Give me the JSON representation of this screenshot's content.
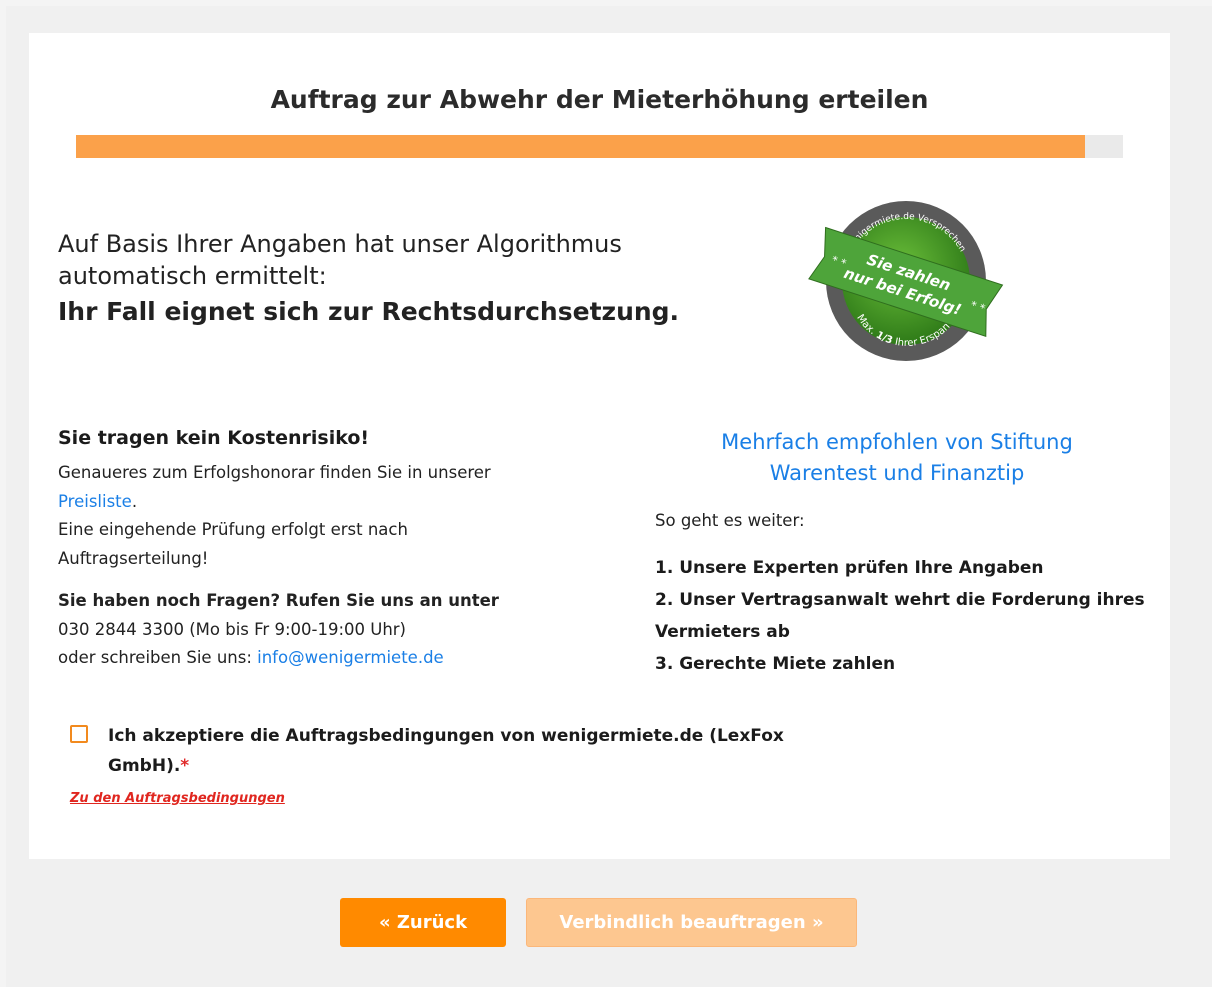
{
  "page": {
    "title": "Auftrag zur Abwehr der Mieterhöhung erteilen",
    "progress_percent": 96.4
  },
  "headline": {
    "line1": "Auf Basis Ihrer Angaben hat unser Algorithmus",
    "line2": "automatisch ermittelt:",
    "strong": "Ihr Fall eignet sich zur Rechtsdurchsetzung."
  },
  "badge": {
    "arc_top": "wenigermiete.de Versprechen",
    "ribbon_line1": "Sie zahlen",
    "ribbon_line2": "nur bei Erfolg!",
    "arc_bottom_prefix": "Max.",
    "arc_bottom_fraction": "1/3",
    "arc_bottom_suffix": "Ihrer Ersparnis",
    "stars": "* *",
    "colors": {
      "green": "#3f8a24",
      "ribbon": "#4aa83a",
      "ring": "#555555"
    }
  },
  "cost": {
    "heading": "Sie tragen kein Kostenrisiko!",
    "line1": "Genaueres zum Erfolgshonorar finden Sie in unserer",
    "price_link": "Preisliste",
    "line2_suffix": ".",
    "line3": "Eine eingehende Prüfung erfolgt erst nach",
    "line4": "Auftragserteilung!"
  },
  "contact": {
    "heading": "Sie haben noch Fragen? Rufen Sie uns an unter",
    "phone": "030 2844 3300 (Mo bis Fr 9:00-19:00 Uhr)",
    "email_prefix": "oder schreiben Sie uns: ",
    "email": "info@wenigermiete.de"
  },
  "recommendation": {
    "line1": "Mehrfach empfohlen von Stiftung",
    "line2": "Warentest und Finanztip"
  },
  "next_steps": {
    "intro": "So geht es weiter:",
    "step1": "1. Unsere Experten prüfen Ihre Angaben",
    "step2a": "2. Unser Vertragsanwalt wehrt die Forderung ihres",
    "step2b": "Vermieters ab",
    "step3": "3. Gerechte Miete zahlen"
  },
  "acceptance": {
    "line1": "Ich akzeptiere die Auftragsbedingungen von wenigermiete.de (LexFox",
    "line2": "GmbH).",
    "required_marker": "*",
    "checked": false,
    "terms_link": "Zu den Auftragsbedingungen"
  },
  "buttons": {
    "back": "« Zurück",
    "submit": "Verbindlich beauftragen »",
    "back_color": "#ff8a00",
    "submit_color": "#fdc790"
  },
  "colors": {
    "accent": "#fba14a",
    "link": "#1a7fe6",
    "required": "#e02a2a"
  }
}
